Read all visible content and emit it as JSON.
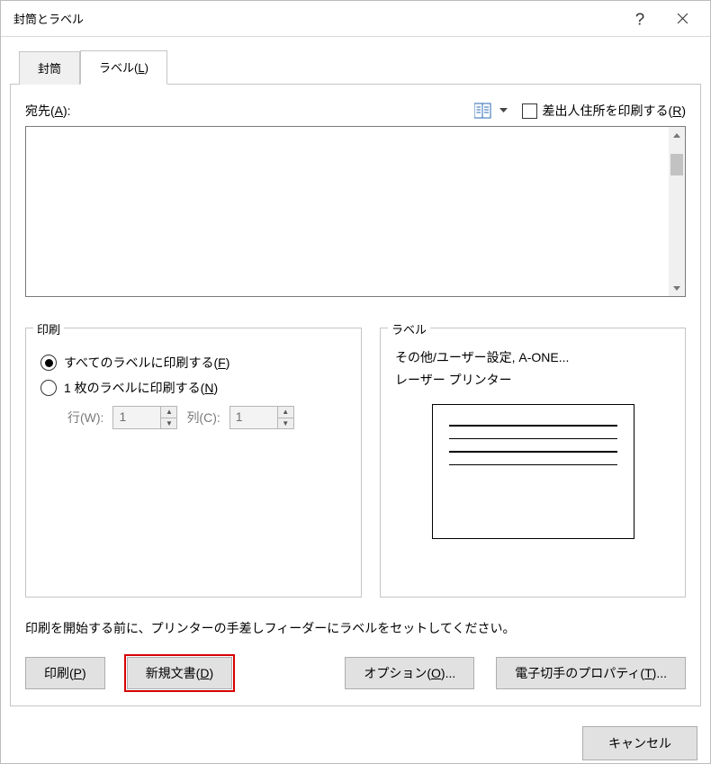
{
  "title": "封筒とラベル",
  "tabs": [
    "封筒",
    "ラベル(L)"
  ],
  "tabs_underline_idx": [
    null,
    4
  ],
  "address_label": "宛先(A):",
  "return_address_label": "差出人住所を印刷する(R)",
  "address_value": "",
  "print_group": {
    "legend": "印刷",
    "radio_all": "すべてのラベルに印刷する(F)",
    "radio_single": "1 枚のラベルに印刷する(N)",
    "row_label": "行(W):",
    "col_label": "列(C):",
    "row_value": "1",
    "col_value": "1"
  },
  "label_group": {
    "legend": "ラベル",
    "line1": "その他/ユーザー設定, A-ONE...",
    "line2": "レーザー プリンター"
  },
  "hint_text": "印刷を開始する前に、プリンターの手差しフィーダーにラベルをセットしてください。",
  "buttons": {
    "print": "印刷(P)",
    "newdoc": "新規文書(D)",
    "options": "オプション(O)...",
    "epostage": "電子切手のプロパティ(T)..."
  },
  "footer_cancel": "キャンセル"
}
